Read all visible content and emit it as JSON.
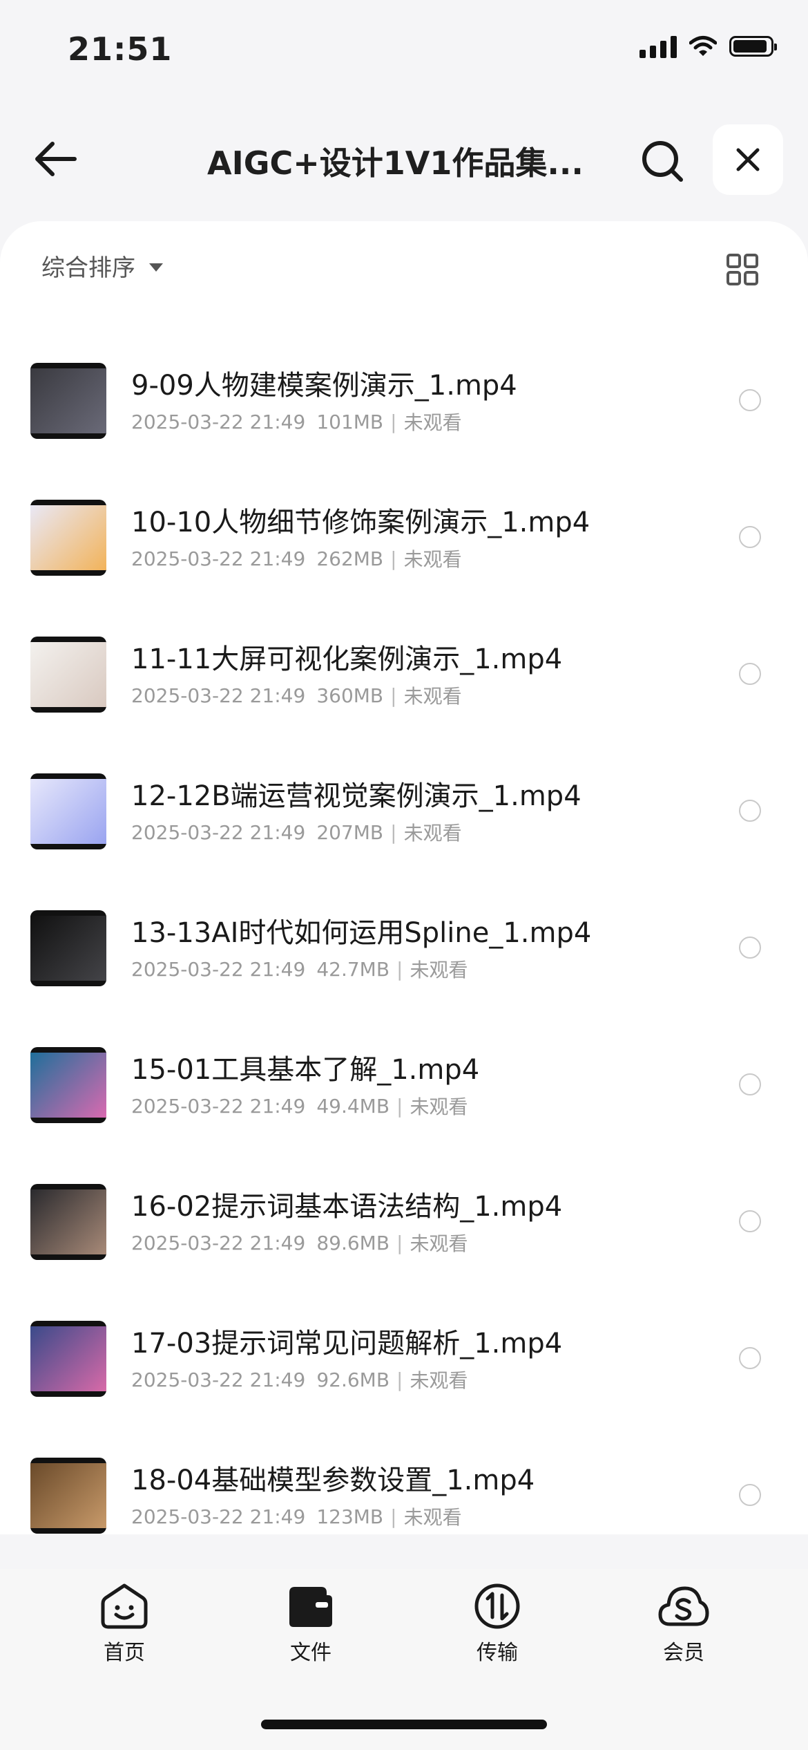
{
  "status_bar": {
    "time": "21:51"
  },
  "header": {
    "title": "AIGC+设计1V1作品集..."
  },
  "toolbar": {
    "sort_label": "综合排序"
  },
  "files": [
    {
      "name": "9-09人物建模案例演示_1.mp4",
      "date": "2025-03-22 21:49",
      "size": "101MB",
      "status": "未观看",
      "thumb_colors": [
        "#3a3a40",
        "#6a6a78"
      ]
    },
    {
      "name": "10-10人物细节修饰案例演示_1.mp4",
      "date": "2025-03-22 21:49",
      "size": "262MB",
      "status": "未观看",
      "thumb_colors": [
        "#e9e8f6",
        "#f2b35a"
      ]
    },
    {
      "name": "11-11大屏可视化案例演示_1.mp4",
      "date": "2025-03-22 21:49",
      "size": "360MB",
      "status": "未观看",
      "thumb_colors": [
        "#f3f1ee",
        "#d9c9c0"
      ]
    },
    {
      "name": "12-12B端运营视觉案例演示_1.mp4",
      "date": "2025-03-22 21:49",
      "size": "207MB",
      "status": "未观看",
      "thumb_colors": [
        "#e6e7fb",
        "#9aa4f0"
      ]
    },
    {
      "name": "13-13AI时代如何运用Spline_1.mp4",
      "date": "2025-03-22 21:49",
      "size": "42.7MB",
      "status": "未观看",
      "thumb_colors": [
        "#111111",
        "#444448"
      ]
    },
    {
      "name": "15-01工具基本了解_1.mp4",
      "date": "2025-03-22 21:49",
      "size": "49.4MB",
      "status": "未观看",
      "thumb_colors": [
        "#1f6f9a",
        "#d96ab0"
      ]
    },
    {
      "name": "16-02提示词基本语法结构_1.mp4",
      "date": "2025-03-22 21:49",
      "size": "89.6MB",
      "status": "未观看",
      "thumb_colors": [
        "#2a2a2e",
        "#a88a78"
      ]
    },
    {
      "name": "17-03提示词常见问题解析_1.mp4",
      "date": "2025-03-22 21:49",
      "size": "92.6MB",
      "status": "未观看",
      "thumb_colors": [
        "#3a4a8a",
        "#d86aa8"
      ]
    },
    {
      "name": "18-04基础模型参数设置_1.mp4",
      "date": "2025-03-22 21:49",
      "size": "123MB",
      "status": "未观看",
      "thumb_colors": [
        "#6a4a2a",
        "#c89a6a"
      ]
    }
  ],
  "nav": [
    {
      "label": "首页",
      "icon": "smile-face-icon"
    },
    {
      "label": "文件",
      "icon": "folder-icon"
    },
    {
      "label": "传输",
      "icon": "transfer-icon"
    },
    {
      "label": "会员",
      "icon": "cloud-s-icon"
    }
  ]
}
